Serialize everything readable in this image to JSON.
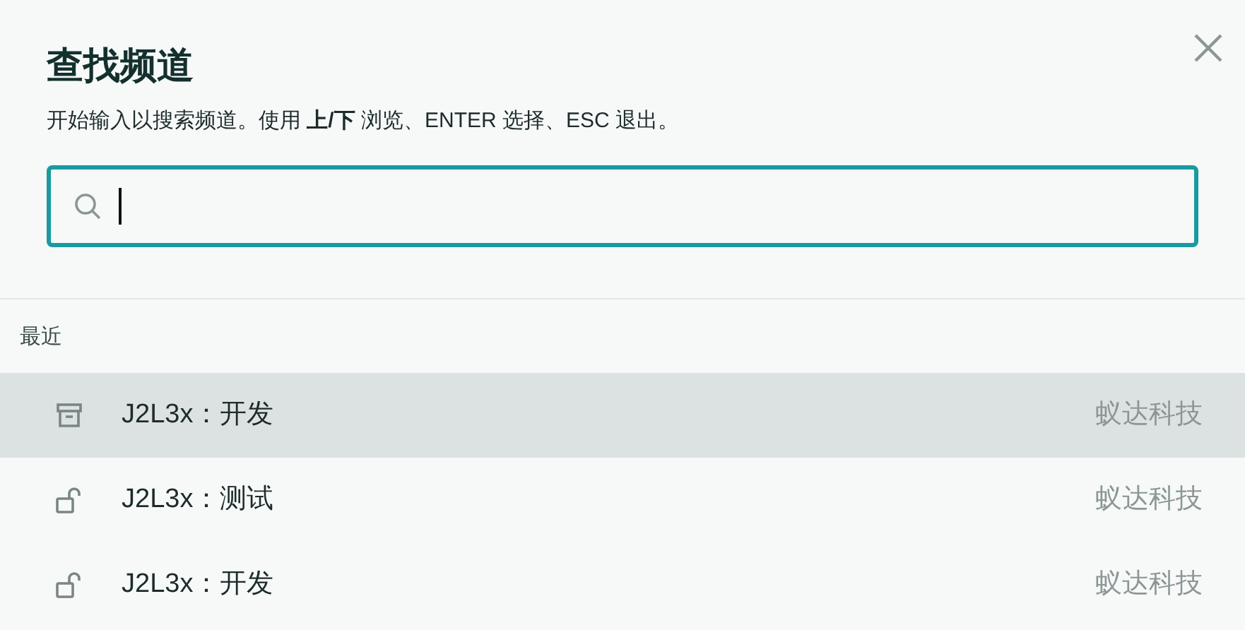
{
  "dialog": {
    "title": "查找频道",
    "hint": "开始输入以搜索频道。使用 **上/下** 浏览、ENTER 选择、ESC 退出。"
  },
  "search": {
    "focused": true
  },
  "recent": {
    "heading": "最近",
    "items": [
      {
        "kind": "archived",
        "name": "J2L3x：开发",
        "team": "蚁达科技",
        "selected": true
      },
      {
        "kind": "public",
        "name": "J2L3x：测试",
        "team": "蚁达科技",
        "selected": false
      },
      {
        "kind": "public",
        "name": "J2L3x：开发",
        "team": "蚁达科技",
        "selected": false
      }
    ]
  }
}
